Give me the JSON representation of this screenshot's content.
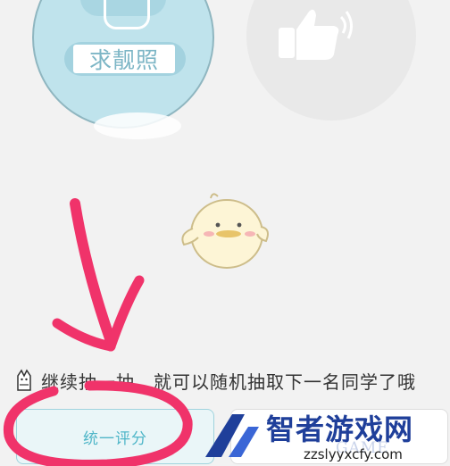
{
  "buttons": {
    "ask_photo_label": "求靓照",
    "unify_score_label": "统一评分"
  },
  "status": {
    "hint_text": "继续抽一抽，就可以随机抽取下一名同学了哦"
  },
  "watermark": {
    "name": "智者游戏网",
    "site": "zzslyyxcfy.com",
    "game_text": "GAME"
  },
  "colors": {
    "accent_teal": "#4fb6c8",
    "annotation_pink": "#f0336a",
    "watermark_blue": "#1f3f9a"
  }
}
